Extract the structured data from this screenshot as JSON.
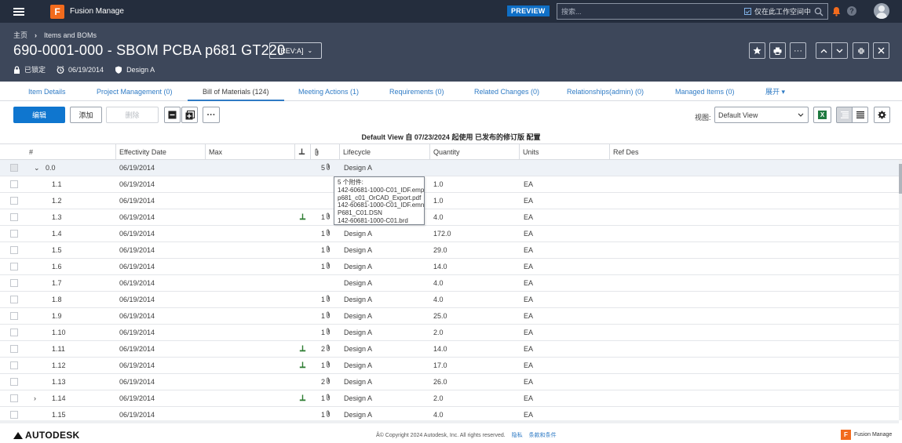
{
  "topbar": {
    "app_name": "Fusion Manage",
    "logo_letter": "F",
    "preview": "PREVIEW",
    "search_placeholder": "搜索...",
    "workspace_only_label": "仅在此工作空间中",
    "workspace_only_checked": true
  },
  "header": {
    "breadcrumb": [
      "主页",
      "Items and BOMs"
    ],
    "title": "690-0001-000 - SBOM PCBA p681 GT220",
    "revision": "[REV:A]",
    "lock_status": "已锁定",
    "date": "06/19/2014",
    "lifecycle": "Design A"
  },
  "tabs": [
    {
      "label": "Item Details",
      "active": false
    },
    {
      "label": "Project Management (0)",
      "active": false
    },
    {
      "label": "Bill of Materials (124)",
      "active": true
    },
    {
      "label": "Meeting Actions (1)",
      "active": false
    },
    {
      "label": "Requirements (0)",
      "active": false
    },
    {
      "label": "Related Changes (0)",
      "active": false
    },
    {
      "label": "Relationships(admin) (0)",
      "active": false
    },
    {
      "label": "Managed Items (0)",
      "active": false
    },
    {
      "label": "展开 ▾",
      "active": false
    }
  ],
  "toolbar": {
    "edit": "编辑",
    "add": "添加",
    "delete": "删除",
    "more": "···",
    "view_label": "视图:",
    "view_value": "Default View"
  },
  "view_caption": "Default View 自 07/23/2024 起使用 已发布的修订版 配置",
  "columns": [
    "#",
    "Effectivity Date",
    "Max",
    "",
    "",
    "Lifecycle",
    "Quantity",
    "Units",
    "Ref Des"
  ],
  "rows": [
    {
      "num": "0.0",
      "expand": "⌄",
      "date": "06/19/2014",
      "pin": false,
      "att": "5",
      "lifecycle": "Design A",
      "qty": "",
      "units": "",
      "sel": true
    },
    {
      "num": "1.1",
      "expand": "",
      "date": "06/19/2014",
      "pin": false,
      "att": "",
      "lifecycle": "",
      "qty": "1.0",
      "units": "EA",
      "sel": false
    },
    {
      "num": "1.2",
      "expand": "",
      "date": "06/19/2014",
      "pin": false,
      "att": "",
      "lifecycle": "",
      "qty": "1.0",
      "units": "EA",
      "sel": false
    },
    {
      "num": "1.3",
      "expand": "",
      "date": "06/19/2014",
      "pin": true,
      "att": "1",
      "lifecycle": "",
      "qty": "4.0",
      "units": "EA",
      "sel": false
    },
    {
      "num": "1.4",
      "expand": "",
      "date": "06/19/2014",
      "pin": false,
      "att": "1",
      "lifecycle": "Design A",
      "qty": "172.0",
      "units": "EA",
      "sel": false
    },
    {
      "num": "1.5",
      "expand": "",
      "date": "06/19/2014",
      "pin": false,
      "att": "1",
      "lifecycle": "Design A",
      "qty": "29.0",
      "units": "EA",
      "sel": false
    },
    {
      "num": "1.6",
      "expand": "",
      "date": "06/19/2014",
      "pin": false,
      "att": "1",
      "lifecycle": "Design A",
      "qty": "14.0",
      "units": "EA",
      "sel": false
    },
    {
      "num": "1.7",
      "expand": "",
      "date": "06/19/2014",
      "pin": false,
      "att": "",
      "lifecycle": "Design A",
      "qty": "4.0",
      "units": "EA",
      "sel": false
    },
    {
      "num": "1.8",
      "expand": "",
      "date": "06/19/2014",
      "pin": false,
      "att": "1",
      "lifecycle": "Design A",
      "qty": "4.0",
      "units": "EA",
      "sel": false
    },
    {
      "num": "1.9",
      "expand": "",
      "date": "06/19/2014",
      "pin": false,
      "att": "1",
      "lifecycle": "Design A",
      "qty": "25.0",
      "units": "EA",
      "sel": false
    },
    {
      "num": "1.10",
      "expand": "",
      "date": "06/19/2014",
      "pin": false,
      "att": "1",
      "lifecycle": "Design A",
      "qty": "2.0",
      "units": "EA",
      "sel": false
    },
    {
      "num": "1.11",
      "expand": "",
      "date": "06/19/2014",
      "pin": true,
      "att": "2",
      "lifecycle": "Design A",
      "qty": "14.0",
      "units": "EA",
      "sel": false
    },
    {
      "num": "1.12",
      "expand": "",
      "date": "06/19/2014",
      "pin": true,
      "att": "1",
      "lifecycle": "Design A",
      "qty": "17.0",
      "units": "EA",
      "sel": false
    },
    {
      "num": "1.13",
      "expand": "",
      "date": "06/19/2014",
      "pin": false,
      "att": "2",
      "lifecycle": "Design A",
      "qty": "26.0",
      "units": "EA",
      "sel": false
    },
    {
      "num": "1.14",
      "expand": "›",
      "date": "06/19/2014",
      "pin": true,
      "att": "1",
      "lifecycle": "Design A",
      "qty": "2.0",
      "units": "EA",
      "sel": false
    },
    {
      "num": "1.15",
      "expand": "",
      "date": "06/19/2014",
      "pin": false,
      "att": "1",
      "lifecycle": "Design A",
      "qty": "4.0",
      "units": "EA",
      "sel": false
    }
  ],
  "tooltip": {
    "lines": [
      "5 个附件:",
      "142-60681-1000-C01_IDF.emp",
      "p681_c01_OrCAD_Export.pdf",
      "142-60681-1000-C01_IDF.emn",
      "P681_C01.DSN",
      "142-60681-1000-C01.brd"
    ]
  },
  "footer": {
    "brand": "AUTODESK",
    "copyright": "Â© Copyright 2024 Autodesk, Inc. All rights reserved.",
    "privacy": "隐私",
    "terms": "条款和条件",
    "product": "Fusion Manage"
  },
  "colors": {
    "topbar": "#242d3d",
    "header": "#3d475a",
    "primary": "#0f76cf",
    "brand_orange": "#f26b1d",
    "link": "#2f7bc5",
    "pin_green": "#2e7d32"
  }
}
